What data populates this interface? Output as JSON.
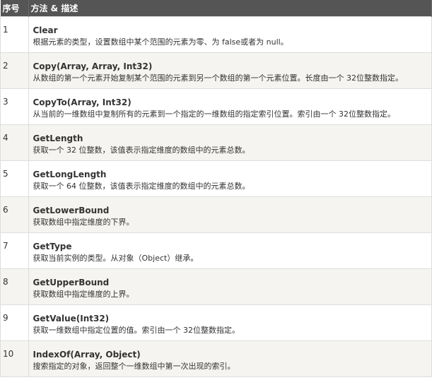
{
  "table": {
    "headers": [
      "序号",
      "方法 & 描述"
    ],
    "rows": [
      {
        "num": "1",
        "name": "Clear",
        "desc": "根据元素的类型，设置数组中某个范围的元素为零、为 false或者为 null。"
      },
      {
        "num": "2",
        "name": "Copy(Array, Array, Int32)",
        "desc": "从数组的第一个元素开始复制某个范围的元素到另一个数组的第一个元素位置。长度由一个 32位整数指定。"
      },
      {
        "num": "3",
        "name": "CopyTo(Array, Int32)",
        "desc": "从当前的一维数组中复制所有的元素到一个指定的一维数组的指定索引位置。索引由一个 32位整数指定。"
      },
      {
        "num": "4",
        "name": "GetLength",
        "desc": "获取一个 32 位整数，该值表示指定维度的数组中的元素总数。"
      },
      {
        "num": "5",
        "name": "GetLongLength",
        "desc": "获取一个 64 位整数，该值表示指定维度的数组中的元素总数。"
      },
      {
        "num": "6",
        "name": "GetLowerBound",
        "desc": "获取数组中指定维度的下界。"
      },
      {
        "num": "7",
        "name": "GetType",
        "desc": "获取当前实例的类型。从对象（Object）继承。"
      },
      {
        "num": "8",
        "name": "GetUpperBound",
        "desc": "获取数组中指定维度的上界。"
      },
      {
        "num": "9",
        "name": "GetValue(Int32)",
        "desc": "获取一维数组中指定位置的值。索引由一个 32位整数指定。"
      },
      {
        "num": "10",
        "name": "IndexOf(Array, Object)",
        "desc": "搜索指定的对象，返回整个一维数组中第一次出现的索引。"
      }
    ]
  },
  "colors": {
    "header_bg": "#555555",
    "header_text": "#ffffff",
    "row_alt_bg": "#f6f4f0",
    "border": "#dddddd"
  }
}
